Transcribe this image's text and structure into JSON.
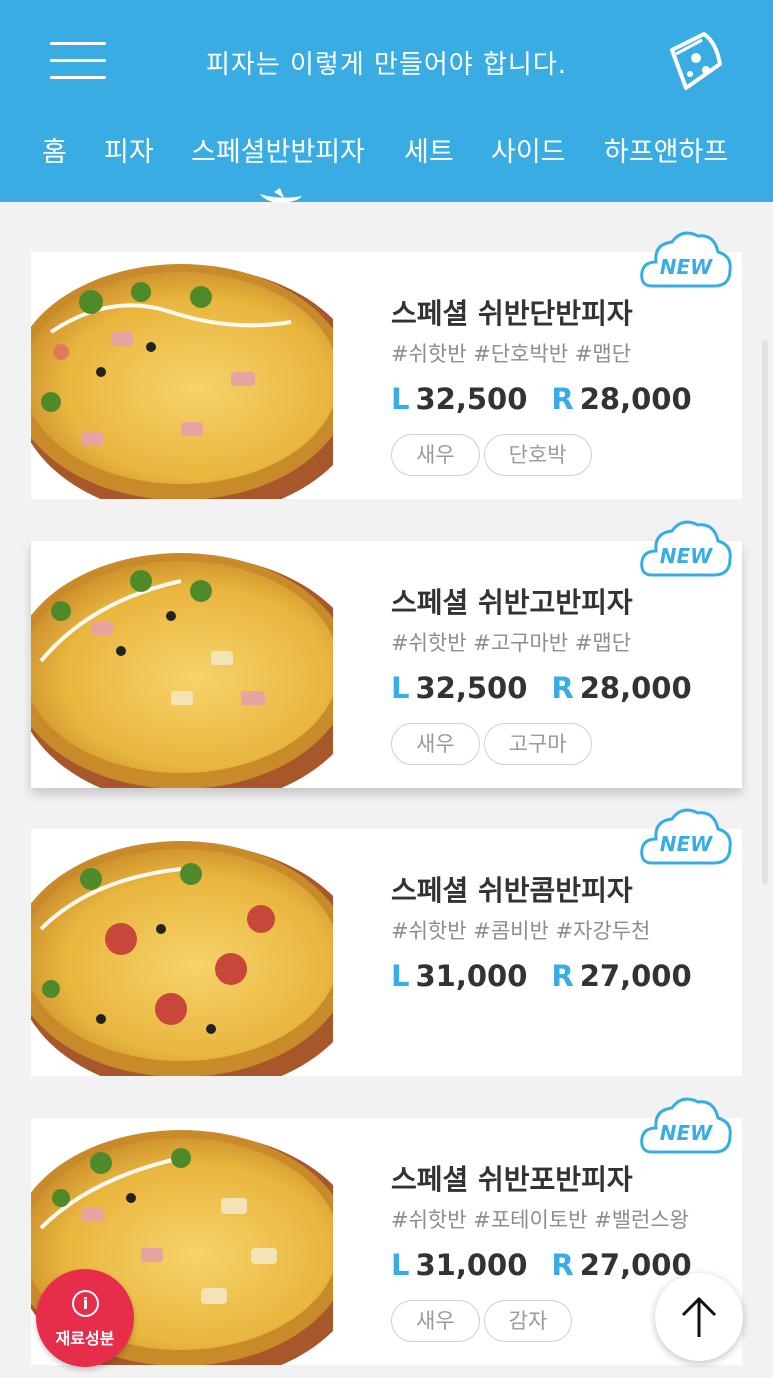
{
  "header": {
    "title": "피자는 이렇게 만들어야 합니다.",
    "background": "#39ade3",
    "tabs": [
      "홈",
      "피자",
      "스페셜반반피자",
      "세트",
      "사이드",
      "하프앤하프"
    ],
    "active_tab": "스페셜반반피자"
  },
  "products": [
    {
      "badge": "NEW",
      "name": "스페셜 쉬반단반피자",
      "tags": "#쉬핫반 #단호박반 #맵단",
      "size_l": "L",
      "price_l": "32,500",
      "size_r": "R",
      "price_r": "28,000",
      "chips": [
        "새우",
        "단호박"
      ]
    },
    {
      "badge": "NEW",
      "name": "스페셜 쉬반고반피자",
      "tags": "#쉬핫반 #고구마반 #맵단",
      "size_l": "L",
      "price_l": "32,500",
      "size_r": "R",
      "price_r": "28,000",
      "chips": [
        "새우",
        "고구마"
      ]
    },
    {
      "badge": "NEW",
      "name": "스페셜 쉬반콤반피자",
      "tags": "#쉬핫반 #콤비반 #자강두천",
      "size_l": "L",
      "price_l": "31,000",
      "size_r": "R",
      "price_r": "27,000",
      "chips": []
    },
    {
      "badge": "NEW",
      "name": "스페셜 쉬반포반피자",
      "tags": "#쉬핫반 #포테이토반 #밸런스왕",
      "size_l": "L",
      "price_l": "31,000",
      "size_r": "R",
      "price_r": "27,000",
      "chips": [
        "새우",
        "감자"
      ]
    }
  ],
  "fab": {
    "info_icon_label": "i",
    "info_label": "재료성분",
    "info_color": "#e62e4b",
    "top_icon": "arrow-up-icon"
  }
}
